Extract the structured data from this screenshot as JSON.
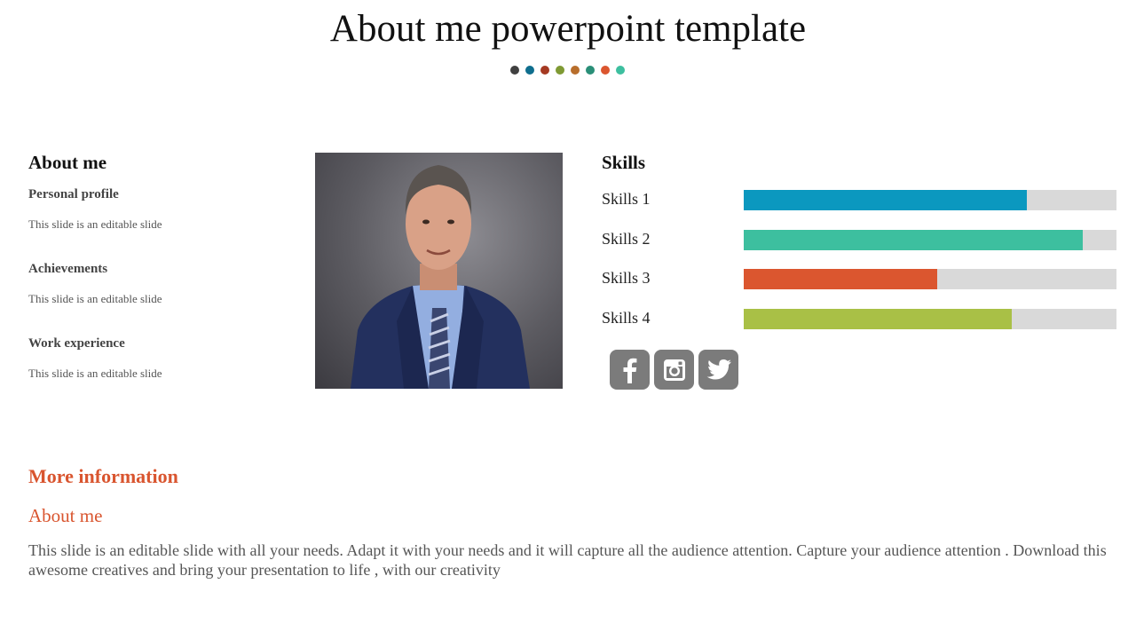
{
  "slide": {
    "title": "About me powerpoint template",
    "dot_colors": [
      "#404040",
      "#0f6e8e",
      "#a53a22",
      "#7f9a34",
      "#b86e2c",
      "#2a8f78",
      "#db562f",
      "#3dbf9f"
    ]
  },
  "about": {
    "heading": "About me",
    "sections": [
      {
        "title": "Personal profile",
        "text": "This slide is an editable slide"
      },
      {
        "title": "Achievements",
        "text": "This slide is an editable slide"
      },
      {
        "title": "Work experience",
        "text": "This slide is an editable slide"
      }
    ],
    "photo_alt": "Portrait of a man in a navy suit"
  },
  "skills": {
    "heading": "Skills",
    "items": [
      {
        "label": "Skills 1",
        "percent": 76,
        "color": "#0b98bf"
      },
      {
        "label": "Skills 2",
        "percent": 91,
        "color": "#3dbf9f"
      },
      {
        "label": "Skills 3",
        "percent": 52,
        "color": "#db562f"
      },
      {
        "label": "Skills 4",
        "percent": 72,
        "color": "#a9c046"
      }
    ],
    "track_color": "#d9d9d9"
  },
  "social": [
    {
      "name": "facebook",
      "icon": "facebook-icon"
    },
    {
      "name": "instagram",
      "icon": "instagram-icon"
    },
    {
      "name": "twitter",
      "icon": "twitter-icon"
    }
  ],
  "more_info": {
    "heading": "More information",
    "subheading": "About me",
    "paragraph": "This slide is an editable slide with all your needs. Adapt it with your needs and it will capture all the audience attention. Capture your audience attention . Download this awesome creatives and bring your presentation to life , with our creativity",
    "accent_color": "#d9552f"
  }
}
